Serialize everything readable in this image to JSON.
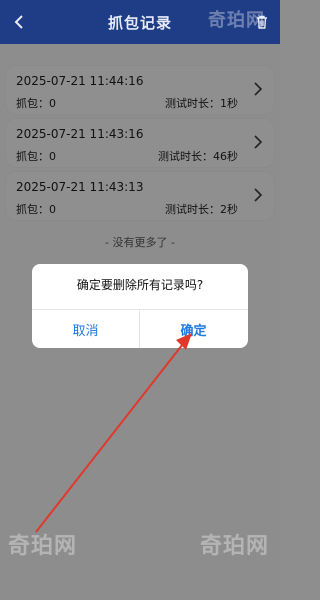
{
  "header": {
    "title": "抓包记录",
    "back_icon": "arrow-left-icon",
    "trash_icon": "trash-icon",
    "background": "#1f3d86"
  },
  "records": [
    {
      "time": "2025-07-21 11:44:16",
      "count_label": "抓包：0",
      "duration": "测试时长：1秒"
    },
    {
      "time": "2025-07-21 11:43:16",
      "count_label": "抓包：0",
      "duration": "测试时长：46秒"
    },
    {
      "time": "2025-07-21 11:43:13",
      "count_label": "抓包：0",
      "duration": "测试时长：2秒"
    }
  ],
  "no_more": "- 没有更多了 -",
  "dialog": {
    "message": "确定要删除所有记录吗?",
    "cancel_label": "取消",
    "confirm_label": "确定",
    "button_color": "#1f7ae0"
  },
  "watermarks": {
    "top": "奇珀网",
    "bottom_left": "奇珀网",
    "bottom_right": "奇珀网"
  },
  "annotation": {
    "arrow_color": "#e0392b"
  }
}
